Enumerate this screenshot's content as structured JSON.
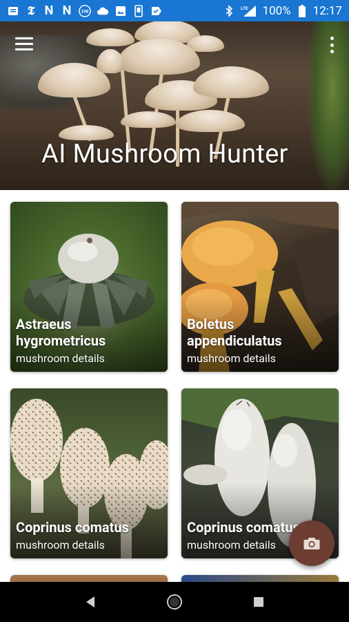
{
  "status_bar": {
    "battery": "100%",
    "time": "12:17",
    "icons": [
      "message-icon",
      "nyt-icon",
      "n-icon",
      "n-icon",
      "counter-badge-icon",
      "cloud-icon",
      "image-icon",
      "phone-icon",
      "check-icon",
      "bluetooth-icon",
      "lte-signal-icon",
      "battery-icon"
    ],
    "badge_count": "108",
    "network": "LTE"
  },
  "header": {
    "title": "AI Mushroom Hunter",
    "menu_icon": "hamburger-menu-icon",
    "more_icon": "more-vertical-icon"
  },
  "cards": [
    {
      "name_line1": "Astraeus",
      "name_line2": "hygrometricus",
      "subtitle": "mushroom details"
    },
    {
      "name_line1": "Boletus",
      "name_line2": "appendiculatus",
      "subtitle": "mushroom details"
    },
    {
      "name_line1": "Coprinus comatus",
      "name_line2": "",
      "subtitle": "mushroom details"
    },
    {
      "name_line1": "Coprinus comatus",
      "name_line2": "",
      "subtitle": "mushroom details"
    }
  ],
  "fab": {
    "icon": "camera-icon",
    "color": "#6d3d32"
  },
  "nav": {
    "back_icon": "back-triangle-icon",
    "home_icon": "home-circle-icon",
    "recents_icon": "recents-square-icon"
  },
  "colors": {
    "status_bar": "#1976d2",
    "fab": "#6d3d32"
  }
}
